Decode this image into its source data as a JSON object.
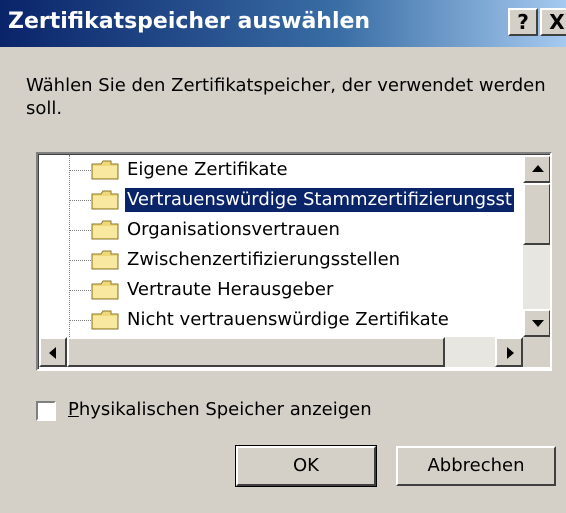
{
  "window": {
    "title": "Zertifikatspeicher auswählen",
    "help_label": "?",
    "close_label": "X"
  },
  "instructions": "Wählen Sie den Zertifikatspeicher, der verwendet werden soll.",
  "tree": {
    "items": [
      {
        "label": "Eigene Zertifikate",
        "icon": "folder-icon",
        "selected": false
      },
      {
        "label": "Vertrauenswürdige Stammzertifizierungsst",
        "icon": "folder-icon",
        "selected": true
      },
      {
        "label": "Organisationsvertrauen",
        "icon": "folder-icon",
        "selected": false
      },
      {
        "label": "Zwischenzertifizierungsstellen",
        "icon": "folder-icon",
        "selected": false
      },
      {
        "label": "Vertraute Herausgeber",
        "icon": "folder-icon",
        "selected": false
      },
      {
        "label": "Nicht vertrauenswürdige Zertifikate",
        "icon": "folder-icon",
        "selected": false
      }
    ]
  },
  "checkbox": {
    "label_first": "P",
    "label_rest": "hysikalischen Speicher anzeigen",
    "checked": false
  },
  "buttons": {
    "ok": "OK",
    "cancel": "Abbrechen"
  },
  "colors": {
    "selection": "#0a246a",
    "dialog_bg": "#d4d0c8",
    "folder": "#f0d878"
  }
}
